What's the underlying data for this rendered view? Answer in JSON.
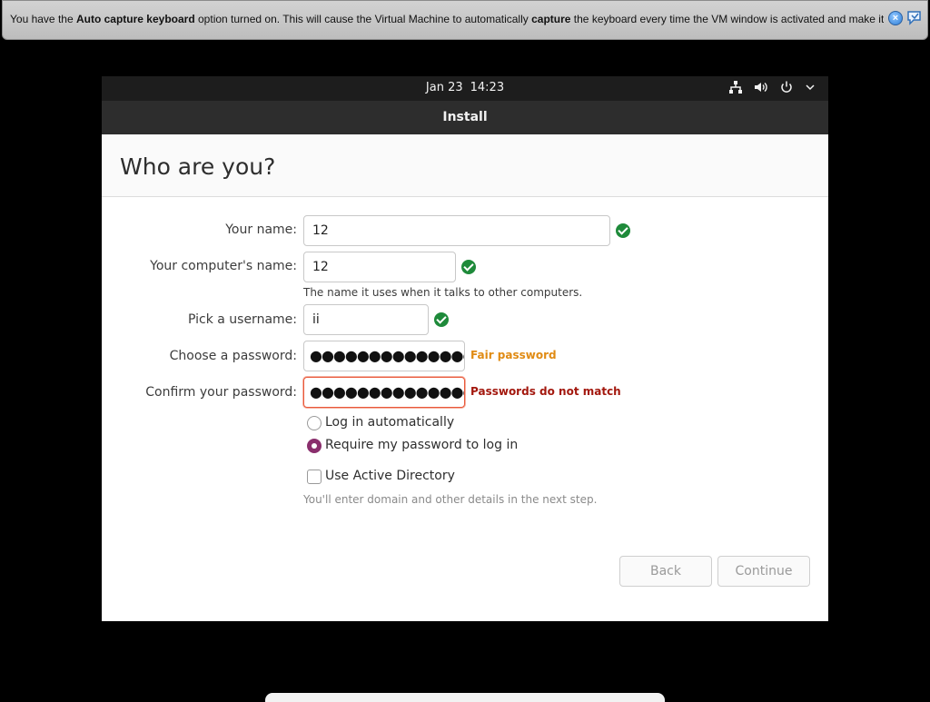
{
  "notification": {
    "segments": [
      {
        "text": "You have the ",
        "bold": false
      },
      {
        "text": "Auto capture keyboard",
        "bold": true
      },
      {
        "text": " option turned on. This will cause the Virtual Machine to automatically ",
        "bold": false
      },
      {
        "text": "capture",
        "bold": true
      },
      {
        "text": " the keyboard every time the VM window is activated and make it unavailable to",
        "bold": false
      }
    ],
    "close_icon": "close-icon",
    "help_icon": "speech-bubble-icon"
  },
  "topbar": {
    "date": "Jan 23",
    "time": "14:23",
    "tray_icons": [
      "network-icon",
      "volume-icon",
      "power-icon",
      "chevron-down-icon"
    ]
  },
  "window": {
    "title": "Install"
  },
  "page": {
    "heading": "Who are you?"
  },
  "form": {
    "name_label": "Your name:",
    "name_value": "12",
    "computer_label": "Your computer's name:",
    "computer_value": "12",
    "computer_hint": "The name it uses when it talks to other computers.",
    "username_label": "Pick a username:",
    "username_value": "ii",
    "password_label": "Choose a password:",
    "password_mask": "●●●●●●●●●●●●●●",
    "password_strength": "Fair password",
    "confirm_label": "Confirm your password:",
    "confirm_mask": "●●●●●●●●●●●●●●",
    "confirm_error": "Passwords do not match"
  },
  "login_options": {
    "auto_label": "Log in automatically",
    "require_label": "Require my password to log in",
    "selected": "require"
  },
  "active_directory": {
    "label": "Use Active Directory",
    "checked": false,
    "note": "You'll enter domain and other details in the next step."
  },
  "buttons": {
    "back": "Back",
    "continue": "Continue"
  },
  "colors": {
    "ok": "#1e8a3a",
    "fair": "#e08b14",
    "error": "#a3180e",
    "accent": "#8a2f6d"
  }
}
